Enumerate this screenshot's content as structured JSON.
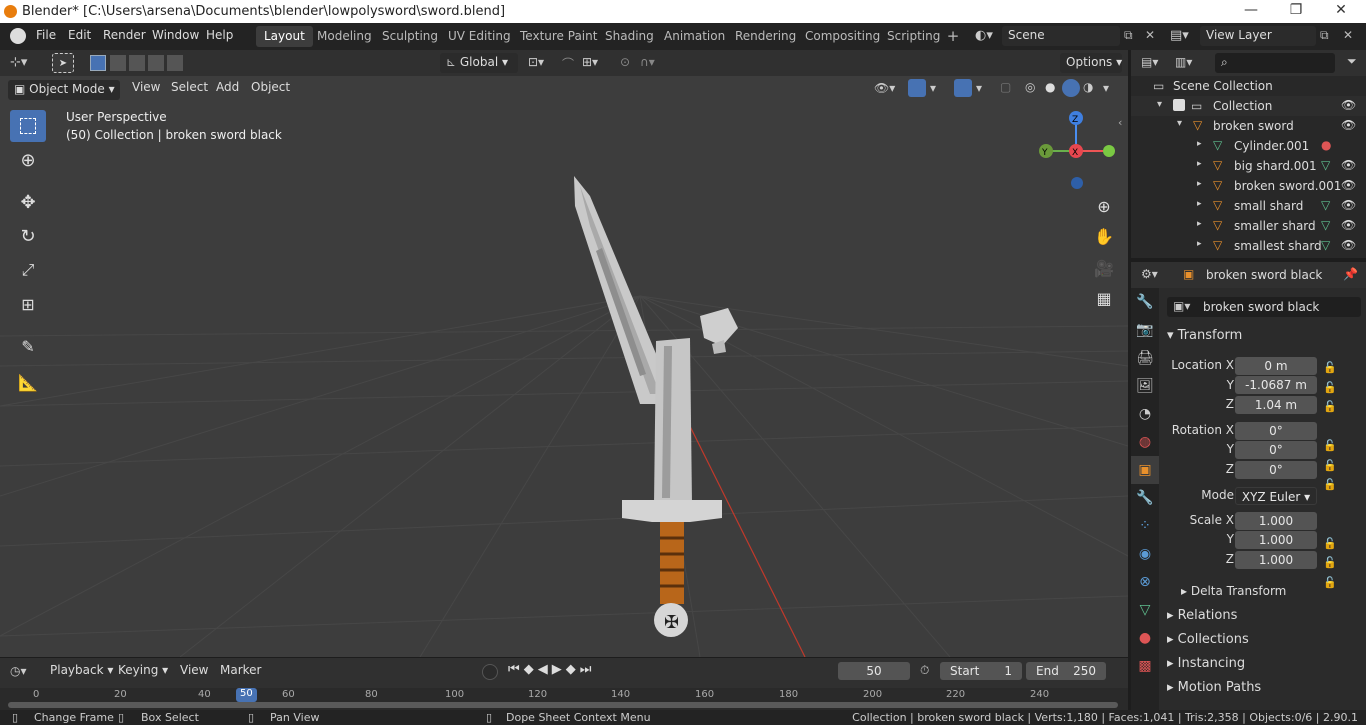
{
  "window": {
    "title": "Blender* [C:\\Users\\arsena\\Documents\\blender\\lowpolysword\\sword.blend]"
  },
  "menu": [
    "File",
    "Edit",
    "Render",
    "Window",
    "Help"
  ],
  "workspaces": [
    "Layout",
    "Modeling",
    "Sculpting",
    "UV Editing",
    "Texture Paint",
    "Shading",
    "Animation",
    "Rendering",
    "Compositing",
    "Scripting"
  ],
  "active_workspace": "Layout",
  "scene": {
    "label": "Scene",
    "view_layer": "View Layer"
  },
  "viewport_header": {
    "mode": "Object Mode",
    "menus": [
      "View",
      "Select",
      "Add",
      "Object"
    ],
    "orientation": "Global",
    "options": "Options"
  },
  "viewport_overlay": {
    "perspective": "User Perspective",
    "context": "(50) Collection | broken sword black"
  },
  "gizmo": {
    "x": "X",
    "y": "Y",
    "z": "Z"
  },
  "outliner": {
    "root": "Scene Collection",
    "collection": "Collection",
    "items": [
      {
        "name": "broken sword",
        "level": 2
      },
      {
        "name": "Cylinder.001",
        "level": 3
      },
      {
        "name": "big shard.001",
        "level": 3
      },
      {
        "name": "broken sword.001",
        "level": 3
      },
      {
        "name": "small shard",
        "level": 3
      },
      {
        "name": "smaller shard",
        "level": 3
      },
      {
        "name": "smallest shard",
        "level": 3
      }
    ]
  },
  "properties": {
    "object_name": "broken sword black",
    "panel": "Transform",
    "location": {
      "label": "Location X",
      "x": "0 m",
      "y": "-1.0687 m",
      "z": "1.04 m"
    },
    "rotation": {
      "label": "Rotation X",
      "x": "0°",
      "y": "0°",
      "z": "0°"
    },
    "mode_label": "Mode",
    "mode": "XYZ Euler",
    "scale": {
      "label": "Scale X",
      "x": "1.000",
      "y": "1.000",
      "z": "1.000"
    },
    "axis_y": "Y",
    "axis_z": "Z",
    "sections": [
      "Delta Transform",
      "Relations",
      "Collections",
      "Instancing",
      "Motion Paths"
    ]
  },
  "timeline": {
    "menus": [
      "Playback",
      "Keying",
      "View",
      "Marker"
    ],
    "current_frame": "50",
    "start_label": "Start",
    "start": "1",
    "end_label": "End",
    "end": "250",
    "ruler": [
      "0",
      "20",
      "40",
      "50",
      "60",
      "80",
      "100",
      "120",
      "140",
      "160",
      "180",
      "200",
      "220",
      "240"
    ]
  },
  "statusbar": {
    "change_frame": "Change Frame",
    "box_select": "Box Select",
    "pan_view": "Pan View",
    "context_menu": "Dope Sheet Context Menu",
    "stats": "Collection | broken sword black | Verts:1,180 | Faces:1,041 | Tris:2,358 | Objects:0/6 | 2.90.1"
  }
}
